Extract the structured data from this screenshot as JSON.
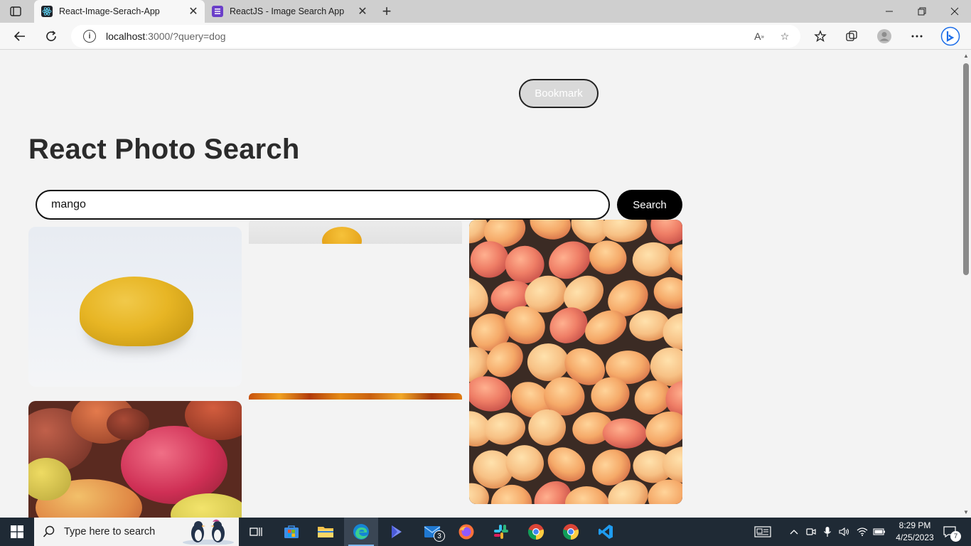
{
  "browser": {
    "tabs": [
      {
        "title": "React-Image-Serach-App",
        "active": true
      },
      {
        "title": "ReactJS - Image Search App",
        "active": false
      }
    ],
    "address": {
      "host": "localhost",
      "path": ":3000/?query=dog"
    }
  },
  "page": {
    "bookmark_label": "Bookmark",
    "heading": "React Photo Search",
    "search": {
      "value": "mango",
      "button_label": "Search"
    }
  },
  "taskbar": {
    "search_placeholder": "Type here to search",
    "mail_badge": "3",
    "time": "8:29 PM",
    "date": "4/25/2023",
    "notification_count": "7"
  },
  "icons": [
    "tab-actions-icon",
    "react-favicon-icon",
    "list-favicon-icon",
    "close-icon",
    "plus-icon",
    "minimize-icon",
    "restore-icon",
    "back-icon",
    "refresh-icon",
    "info-icon",
    "read-aloud-icon",
    "add-favorite-icon",
    "favorites-icon",
    "collections-icon",
    "profile-icon",
    "more-icon",
    "bing-icon",
    "windows-start-icon",
    "search-icon",
    "task-view-icon",
    "store-icon",
    "file-explorer-icon",
    "edge-icon",
    "mail-icon",
    "firefox-icon",
    "slack-icon",
    "chrome-icon",
    "vscode-icon"
  ]
}
